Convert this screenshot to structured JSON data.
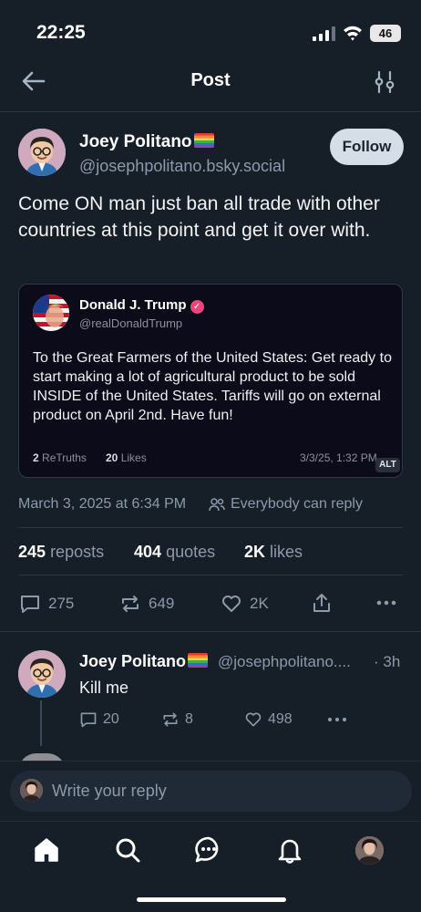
{
  "status_bar": {
    "time": "22:25",
    "battery": "46"
  },
  "header": {
    "title": "Post"
  },
  "post": {
    "author_name": "Joey Politano",
    "author_handle": "@josephpolitano.bsky.social",
    "follow_label": "Follow",
    "text": "Come ON man just ban all trade with other countries at this point and get it over with.",
    "timestamp": "March 3, 2025 at 6:34 PM",
    "reply_setting": "Everybody can reply",
    "stats": {
      "reposts": "245",
      "reposts_label": "reposts",
      "quotes": "404",
      "quotes_label": "quotes",
      "likes": "2K",
      "likes_label": "likes"
    },
    "actions": {
      "replies": "275",
      "reposts": "649",
      "likes": "2K"
    }
  },
  "quote": {
    "name": "Donald J. Trump",
    "handle": "@realDonaldTrump",
    "text": "To the Great Farmers of the United States: Get ready to start making a lot of agricultural product to be sold INSIDE of the United States. Tariffs will go on external product on April 2nd. Have fun!",
    "retruths": "2",
    "retruths_label": "ReTruths",
    "likes": "20",
    "likes_label": "Likes",
    "date": "3/3/25, 1:32 PM",
    "alt_badge": "ALT"
  },
  "reply": {
    "author_name": "Joey Politano",
    "author_handle": "@josephpolitano....",
    "time": "· 3h",
    "text": "Kill me",
    "replies": "20",
    "reposts": "8",
    "likes": "498"
  },
  "composer": {
    "placeholder": "Write your reply"
  },
  "nav": [
    "home-icon",
    "search-icon",
    "chat-icon",
    "bell-icon",
    "profile-avatar"
  ],
  "colors": {
    "background": "#161e27",
    "secondary_text": "#8c9aab",
    "follow_button": "#d5dde6",
    "quote_card": "#0c0b1a"
  }
}
